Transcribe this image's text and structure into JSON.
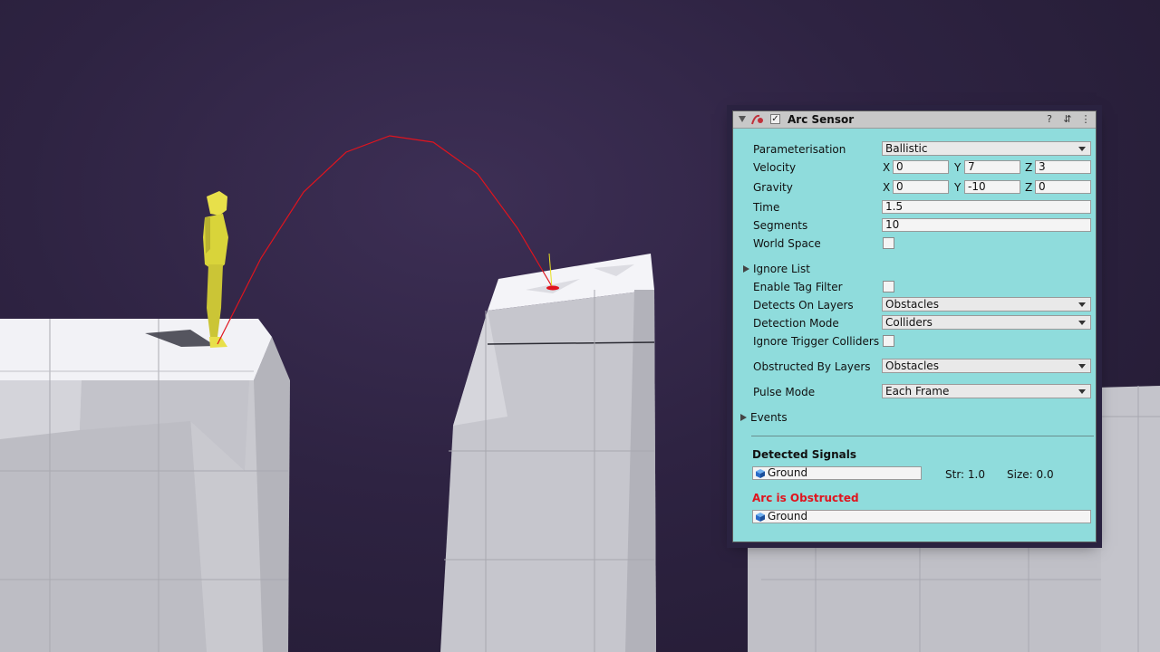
{
  "component": {
    "title": "Arc Sensor",
    "enabled": true
  },
  "fields": {
    "parameterisation": {
      "label": "Parameterisation",
      "value": "Ballistic"
    },
    "velocity": {
      "label": "Velocity",
      "x": "0",
      "y": "7",
      "z": "3"
    },
    "gravity": {
      "label": "Gravity",
      "x": "0",
      "y": "-10",
      "z": "0"
    },
    "time": {
      "label": "Time",
      "value": "1.5"
    },
    "segments": {
      "label": "Segments",
      "value": "10"
    },
    "world_space": {
      "label": "World Space",
      "checked": false
    },
    "ignore_list": {
      "label": "Ignore List"
    },
    "enable_tag_filter": {
      "label": "Enable Tag Filter",
      "checked": false
    },
    "detects_on_layers": {
      "label": "Detects On Layers",
      "value": "Obstacles"
    },
    "detection_mode": {
      "label": "Detection Mode",
      "value": "Colliders"
    },
    "ignore_trigger_colliders": {
      "label": "Ignore Trigger Colliders",
      "checked": false
    },
    "obstructed_by_layers": {
      "label": "Obstructed By Layers",
      "value": "Obstacles"
    },
    "pulse_mode": {
      "label": "Pulse Mode",
      "value": "Each Frame"
    },
    "events": {
      "label": "Events"
    }
  },
  "axis_labels": {
    "x": "X",
    "y": "Y",
    "z": "Z"
  },
  "detected": {
    "title": "Detected Signals",
    "object": "Ground",
    "strength": "Str: 1.0",
    "size": "Size: 0.0"
  },
  "obstructed": {
    "title": "Arc is Obstructed",
    "object": "Ground"
  },
  "colors": {
    "panel_bg": "#8fdcdc",
    "arc": "#e0141e",
    "character": "#d9d43a",
    "obstructed_text": "#e0141e"
  }
}
